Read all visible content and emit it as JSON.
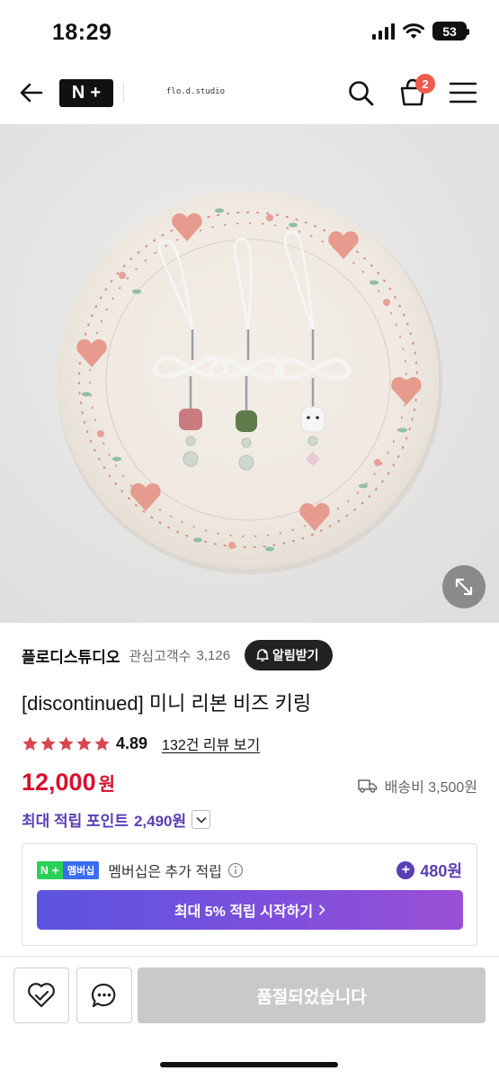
{
  "status_bar": {
    "time": "18:29",
    "battery": "53"
  },
  "header": {
    "logo_n": "N",
    "logo_plus": "+",
    "store_handle": "flo.d.studio",
    "cart_count": "2"
  },
  "product": {
    "store_name": "플로디스튜디오",
    "favorites_label": "관심고객수",
    "favorites_count": "3,126",
    "notify_label": "알림받기",
    "title": "[discontinued] 미니 리본 비즈 키링",
    "rating": "4.89",
    "rating_stars": 5,
    "review_link": "132건 리뷰 보기",
    "price": "12,000",
    "price_unit": "원",
    "shipping": "배송비 3,500원",
    "points_label": "최대 적립 포인트",
    "points_value": "2,490원"
  },
  "membership": {
    "badge_n": "N",
    "badge_plus": "+",
    "badge_label": "멤버십",
    "text": "멤버십은 추가 적립",
    "bonus": "480원",
    "cta_label": "최대 5% 적립 시작하기"
  },
  "actions": {
    "soldout_label": "품절되었습니다"
  },
  "colors": {
    "price": "#d8102e",
    "points": "#5a3fb5",
    "star": "#d9454f",
    "badge": "#f05b4f",
    "cta_start": "#5b54e0",
    "cta_end": "#9a4fd6",
    "soldout": "#c9c9cc"
  },
  "icons": {
    "back": "arrow-left-icon",
    "search": "search-icon",
    "cart": "shopping-bag-icon",
    "menu": "hamburger-menu-icon",
    "expand": "expand-arrows-icon",
    "bell": "bell-plus-icon",
    "truck": "truck-icon",
    "info": "info-icon",
    "like": "heart-check-icon",
    "chat": "chat-bubble-icon"
  }
}
